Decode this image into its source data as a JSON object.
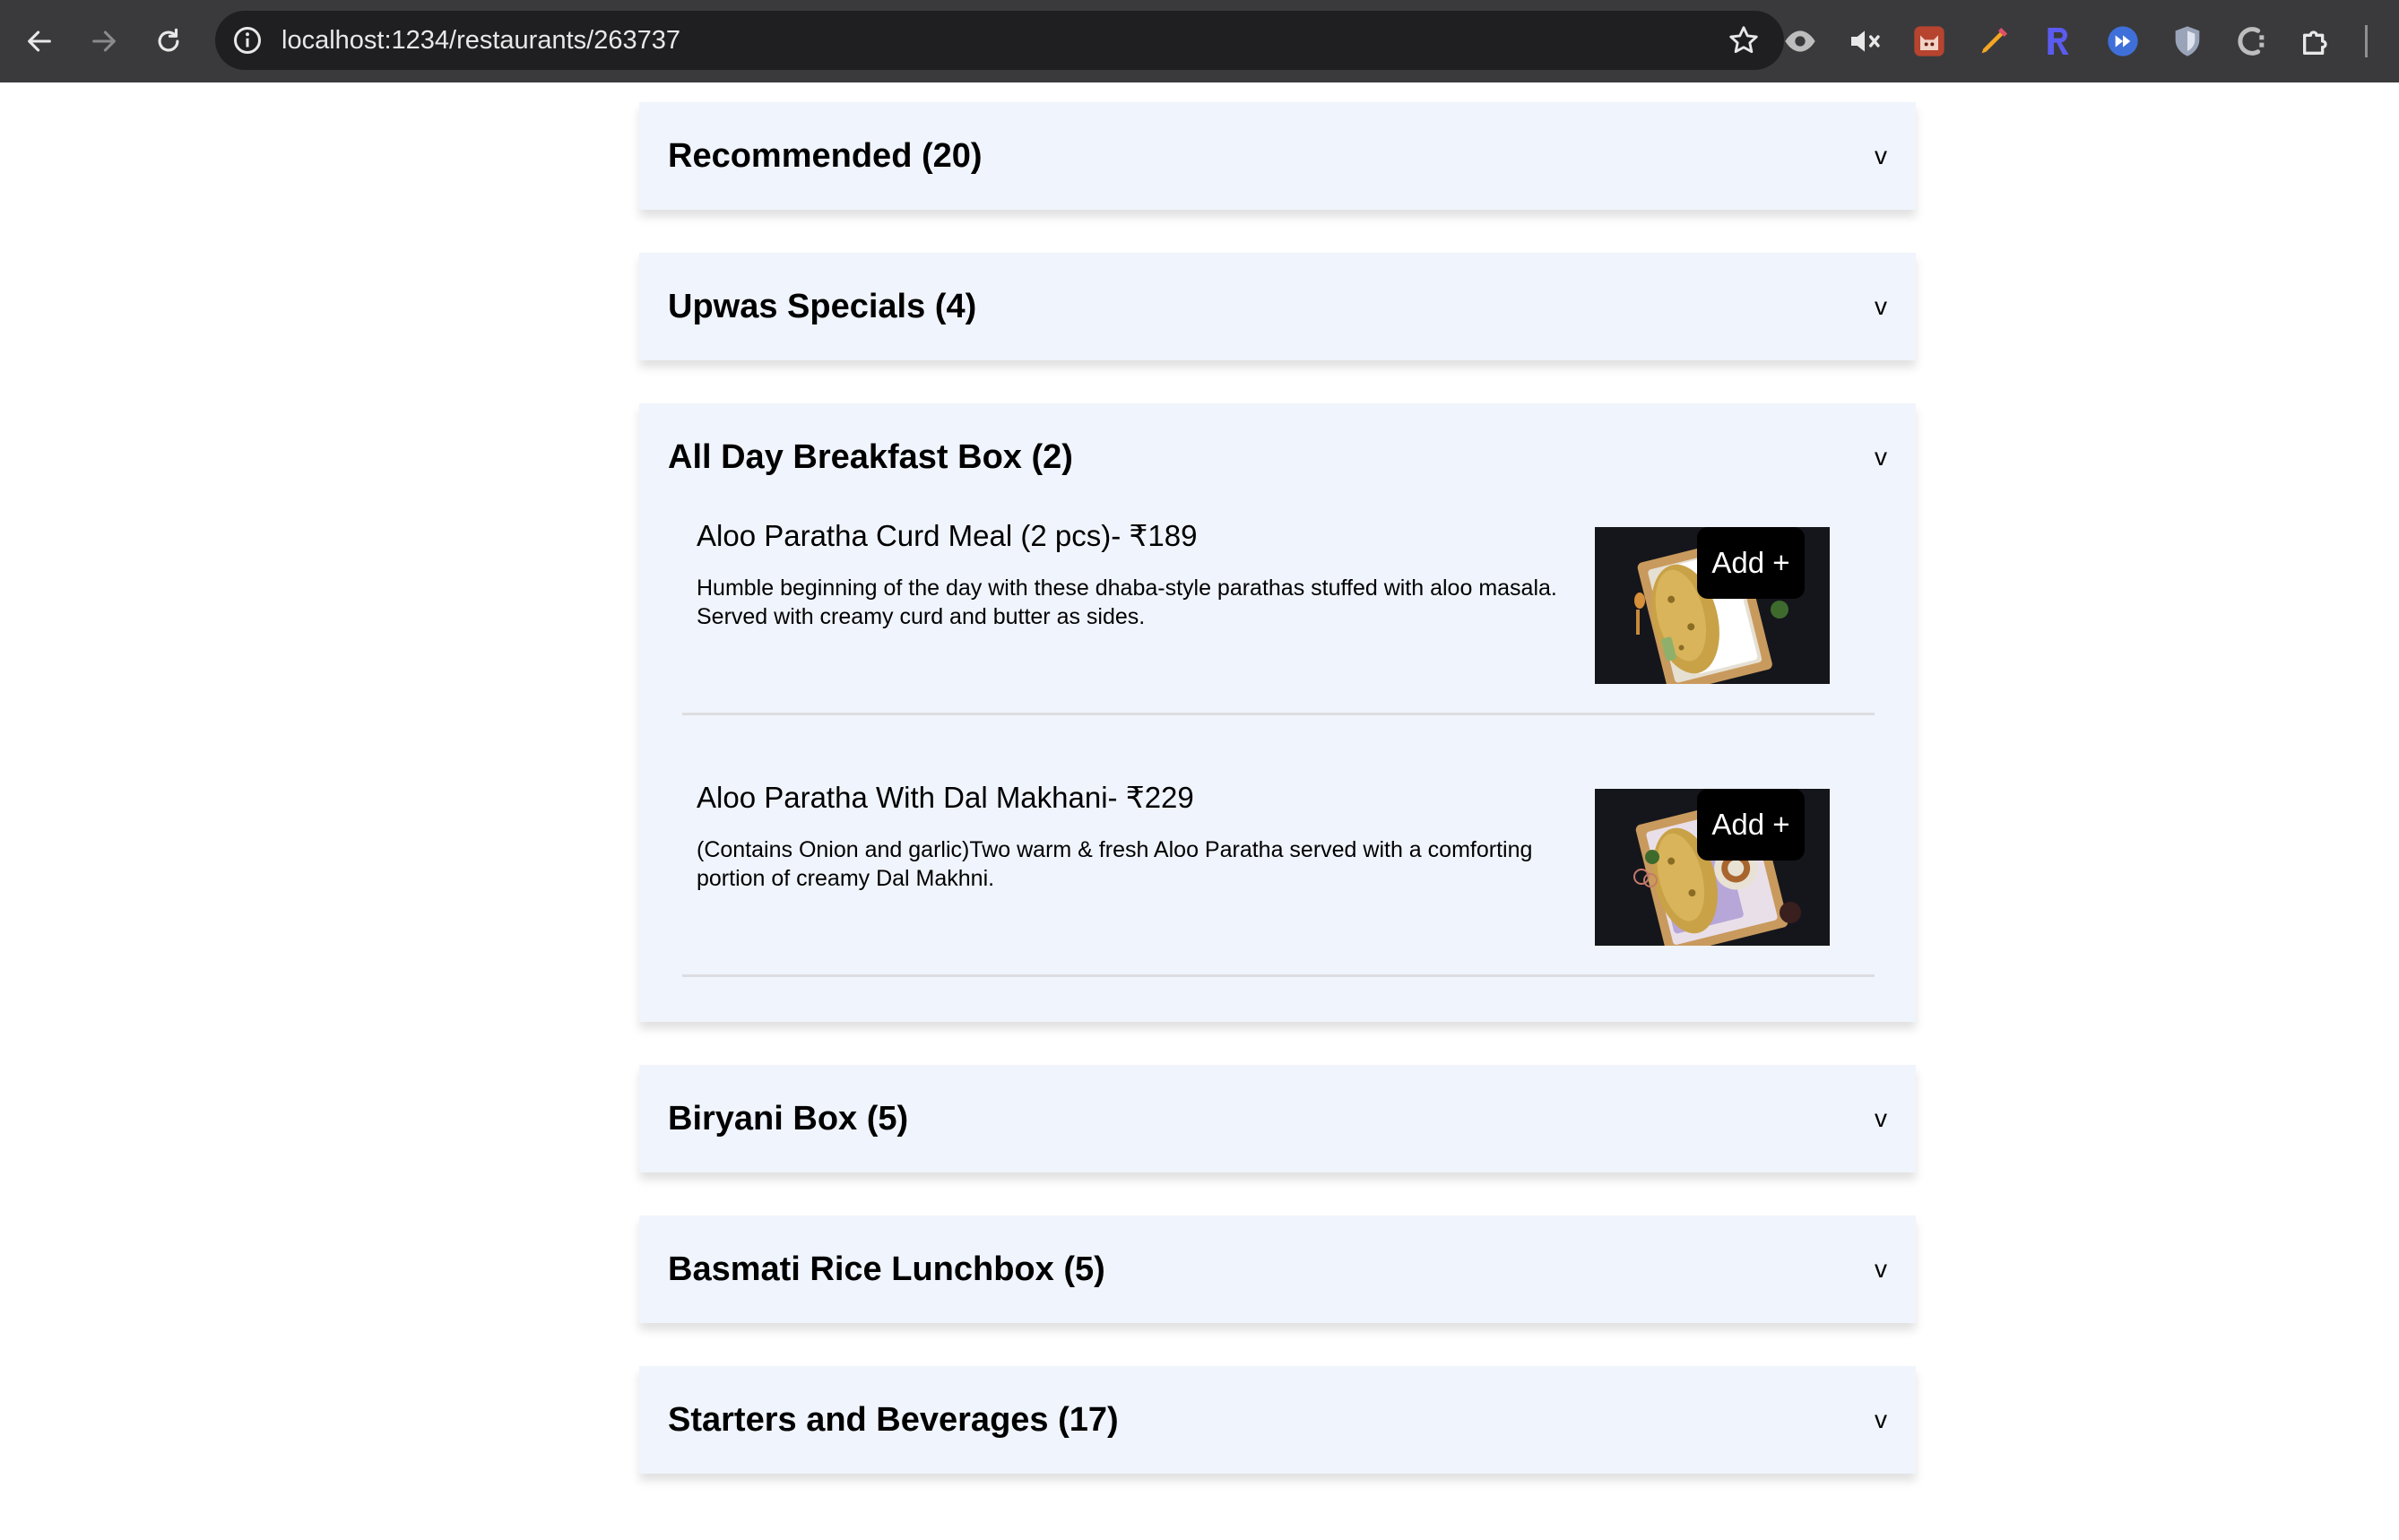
{
  "browser": {
    "url": "localhost:1234/restaurants/263737",
    "icons": [
      "back-arrow-icon",
      "forward-arrow-icon",
      "reload-icon",
      "site-info-icon",
      "bookmark-star-icon",
      "eye-extension-icon",
      "muted-speaker-icon",
      "cat-extension-icon",
      "pen-extension-icon",
      "r-extension-icon",
      "fast-forward-extension-icon",
      "shield-extension-icon",
      "c-extension-icon",
      "puzzle-extensions-icon"
    ]
  },
  "menu": {
    "chevron": "v",
    "categories": [
      {
        "title": "Recommended (20)"
      },
      {
        "title": "Upwas Specials (4)"
      },
      {
        "title": "All Day Breakfast Box (2)",
        "expanded": true,
        "items": [
          {
            "name": "Aloo Paratha Curd Meal (2 pcs)- ₹189",
            "description": "Humble beginning of the day with these dhaba-style parathas stuffed with aloo masala. Served with creamy curd and butter as sides.",
            "add_label": "Add +"
          },
          {
            "name": "Aloo Paratha With Dal Makhani- ₹229",
            "description": "(Contains Onion and garlic)Two warm & fresh Aloo Paratha served with a comforting portion of creamy Dal Makhni.",
            "add_label": "Add +"
          }
        ]
      },
      {
        "title": "Biryani Box (5)"
      },
      {
        "title": "Basmati Rice Lunchbox (5)"
      },
      {
        "title": "Starters and Beverages (17)"
      }
    ]
  }
}
